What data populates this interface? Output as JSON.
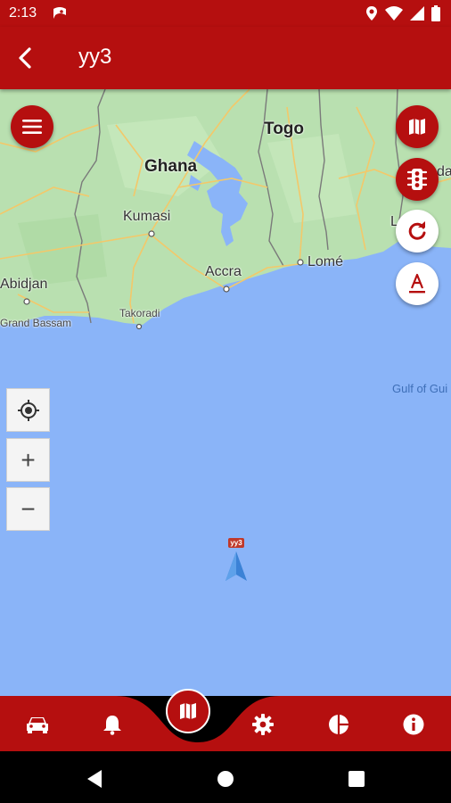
{
  "status_bar": {
    "time": "2:13"
  },
  "app_bar": {
    "title": "yy3"
  },
  "map": {
    "labels": {
      "ghana": "Ghana",
      "togo": "Togo",
      "kumasi": "Kumasi",
      "accra": "Accra",
      "lome": "Lomé",
      "abidjan": "Abidjan",
      "grand_bassam": "Grand Bassam",
      "takoradi": "Takoradi",
      "gulf": "Gulf of Gui",
      "edge_l": "L",
      "edge_da": "da"
    },
    "vehicle_plate": "yy3",
    "zoom_in": "+",
    "zoom_out": "−"
  },
  "colors": {
    "brand_red": "#b50f0f",
    "water": "#8ab4f8",
    "land": "#b9e0b0"
  }
}
